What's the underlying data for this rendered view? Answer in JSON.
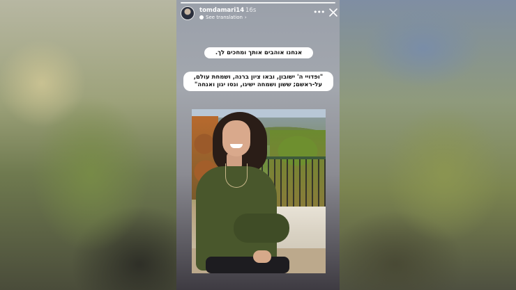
{
  "story": {
    "username": "tomdamari14",
    "time_ago": "16s",
    "see_translation": "See translation",
    "more_icon": "more-icon",
    "close_icon": "close-icon",
    "text_line1": "אנחנו אוהבים אותך ומחכים לך.",
    "quote_line1": "\"ופדויי ה' ישובון, ובאו ציון ברנה, ושמחת עולם,",
    "quote_line2": "על-ראשם; ששון ושמחה ישיגו, ונסו יגון ואנחה\"",
    "photo_description": "photo-of-woman",
    "progress": 1
  }
}
